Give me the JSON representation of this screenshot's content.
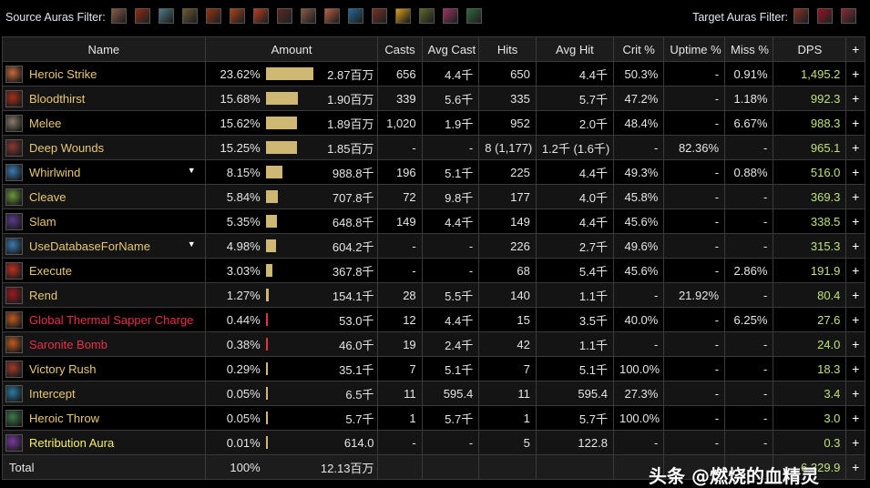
{
  "filters": {
    "source_label": "Source Auras Filter:",
    "source_auras": [
      {
        "name": "flex-arm",
        "color": "#8a5a44"
      },
      {
        "name": "bloodrage",
        "color": "#9a2a10"
      },
      {
        "name": "battle-shout",
        "color": "#4a7a8a"
      },
      {
        "name": "demoralizing",
        "color": "#6a5a30"
      },
      {
        "name": "rampage",
        "color": "#a03010"
      },
      {
        "name": "berserker",
        "color": "#b04010"
      },
      {
        "name": "enrage-fist",
        "color": "#c03a20"
      },
      {
        "name": "claw",
        "color": "#5a2a20"
      },
      {
        "name": "flex-arm-2",
        "color": "#8a5a44"
      },
      {
        "name": "heroic-strike",
        "color": "#c06040"
      },
      {
        "name": "blue-figure",
        "color": "#1a6a9a"
      },
      {
        "name": "demon",
        "color": "#7a3020"
      },
      {
        "name": "fire-yellow",
        "color": "#e0a010"
      },
      {
        "name": "green-beast",
        "color": "#5a6a20"
      },
      {
        "name": "potion",
        "color": "#a03060"
      },
      {
        "name": "green-hand",
        "color": "#2a6a3a"
      }
    ],
    "target_label": "Target Auras Filter:",
    "target_auras": [
      {
        "name": "sunder",
        "color": "#8a3020"
      },
      {
        "name": "rend",
        "color": "#a01020"
      },
      {
        "name": "deep-wounds",
        "color": "#8a2a30"
      }
    ]
  },
  "table": {
    "headers": [
      "Name",
      "Amount",
      "Casts",
      "Avg Cast",
      "Hits",
      "Avg Hit",
      "Crit %",
      "Uptime %",
      "Miss %",
      "DPS",
      "+"
    ],
    "rows": [
      {
        "name": "Heroic Strike",
        "style": "",
        "icon_color": "#c66a3a",
        "pct": "23.62%",
        "bar_fraction": 1.0,
        "bar_color": "gold",
        "amount": "2.87百万",
        "casts": "656",
        "avg_cast": "4.4千",
        "hits": "650",
        "avg_hit": "4.4千",
        "crit": "50.3%",
        "uptime": "-",
        "miss": "0.91%",
        "dps": "1,495.2",
        "expand": false
      },
      {
        "name": "Bloodthirst",
        "style": "",
        "icon_color": "#a8301a",
        "pct": "15.68%",
        "bar_fraction": 0.664,
        "bar_color": "gold",
        "amount": "1.90百万",
        "casts": "339",
        "avg_cast": "5.6千",
        "hits": "335",
        "avg_hit": "5.7千",
        "crit": "47.2%",
        "uptime": "-",
        "miss": "1.18%",
        "dps": "992.3",
        "expand": false
      },
      {
        "name": "Melee",
        "style": "",
        "icon_color": "#8a7a6a",
        "pct": "15.62%",
        "bar_fraction": 0.661,
        "bar_color": "gold",
        "amount": "1.89百万",
        "casts": "1,020",
        "avg_cast": "1.9千",
        "hits": "952",
        "avg_hit": "2.0千",
        "crit": "48.4%",
        "uptime": "-",
        "miss": "6.67%",
        "dps": "988.3",
        "expand": false
      },
      {
        "name": "Deep Wounds",
        "style": "",
        "icon_color": "#8a3a30",
        "pct": "15.25%",
        "bar_fraction": 0.646,
        "bar_color": "gold",
        "amount": "1.85百万",
        "casts": "-",
        "avg_cast": "-",
        "hits": "8 (1,177)",
        "avg_hit": "1.2千 (1.6千)",
        "crit": "-",
        "uptime": "82.36%",
        "miss": "-",
        "dps": "965.1",
        "expand": false
      },
      {
        "name": "Whirlwind",
        "style": "",
        "icon_color": "#3a7ab0",
        "pct": "8.15%",
        "bar_fraction": 0.345,
        "bar_color": "gold",
        "amount": "988.8千",
        "casts": "196",
        "avg_cast": "5.1千",
        "hits": "225",
        "avg_hit": "4.4千",
        "crit": "49.3%",
        "uptime": "-",
        "miss": "0.88%",
        "dps": "516.0",
        "expand": true
      },
      {
        "name": "Cleave",
        "style": "",
        "icon_color": "#6a9a3a",
        "pct": "5.84%",
        "bar_fraction": 0.247,
        "bar_color": "gold",
        "amount": "707.8千",
        "casts": "72",
        "avg_cast": "9.8千",
        "hits": "177",
        "avg_hit": "4.0千",
        "crit": "45.8%",
        "uptime": "-",
        "miss": "-",
        "dps": "369.3",
        "expand": false
      },
      {
        "name": "Slam",
        "style": "",
        "icon_color": "#5a3a8a",
        "pct": "5.35%",
        "bar_fraction": 0.227,
        "bar_color": "gold",
        "amount": "648.8千",
        "casts": "149",
        "avg_cast": "4.4千",
        "hits": "149",
        "avg_hit": "4.4千",
        "crit": "45.6%",
        "uptime": "-",
        "miss": "-",
        "dps": "338.5",
        "expand": false
      },
      {
        "name": "UseDatabaseForName",
        "style": "",
        "icon_color": "#3a7ab0",
        "pct": "4.98%",
        "bar_fraction": 0.211,
        "bar_color": "gold",
        "amount": "604.2千",
        "casts": "-",
        "avg_cast": "-",
        "hits": "226",
        "avg_hit": "2.7千",
        "crit": "49.6%",
        "uptime": "-",
        "miss": "-",
        "dps": "315.3",
        "expand": true
      },
      {
        "name": "Execute",
        "style": "",
        "icon_color": "#c03020",
        "pct": "3.03%",
        "bar_fraction": 0.128,
        "bar_color": "gold",
        "amount": "367.8千",
        "casts": "-",
        "avg_cast": "-",
        "hits": "68",
        "avg_hit": "5.4千",
        "crit": "45.6%",
        "uptime": "-",
        "miss": "2.86%",
        "dps": "191.9",
        "expand": false
      },
      {
        "name": "Rend",
        "style": "",
        "icon_color": "#a01a20",
        "pct": "1.27%",
        "bar_fraction": 0.054,
        "bar_color": "gold",
        "amount": "154.1千",
        "casts": "28",
        "avg_cast": "5.5千",
        "hits": "140",
        "avg_hit": "1.1千",
        "crit": "-",
        "uptime": "21.92%",
        "miss": "-",
        "dps": "80.4",
        "expand": false
      },
      {
        "name": "Global Thermal Sapper Charge",
        "style": "red",
        "icon_color": "#c05a20",
        "pct": "0.44%",
        "bar_fraction": 0.019,
        "bar_color": "red",
        "amount": "53.0千",
        "casts": "12",
        "avg_cast": "4.4千",
        "hits": "15",
        "avg_hit": "3.5千",
        "crit": "40.0%",
        "uptime": "-",
        "miss": "6.25%",
        "dps": "27.6",
        "expand": false
      },
      {
        "name": "Saronite Bomb",
        "style": "red",
        "icon_color": "#c05a20",
        "pct": "0.38%",
        "bar_fraction": 0.016,
        "bar_color": "red",
        "amount": "46.0千",
        "casts": "19",
        "avg_cast": "2.4千",
        "hits": "42",
        "avg_hit": "1.1千",
        "crit": "-",
        "uptime": "-",
        "miss": "-",
        "dps": "24.0",
        "expand": false
      },
      {
        "name": "Victory Rush",
        "style": "",
        "icon_color": "#a03a2a",
        "pct": "0.29%",
        "bar_fraction": 0.012,
        "bar_color": "gold",
        "amount": "35.1千",
        "casts": "7",
        "avg_cast": "5.1千",
        "hits": "7",
        "avg_hit": "5.1千",
        "crit": "100.0%",
        "uptime": "-",
        "miss": "-",
        "dps": "18.3",
        "expand": false
      },
      {
        "name": "Intercept",
        "style": "",
        "icon_color": "#2a7aa0",
        "pct": "0.05%",
        "bar_fraction": 0.002,
        "bar_color": "gold",
        "amount": "6.5千",
        "casts": "11",
        "avg_cast": "595.4",
        "hits": "11",
        "avg_hit": "595.4",
        "crit": "27.3%",
        "uptime": "-",
        "miss": "-",
        "dps": "3.4",
        "expand": false
      },
      {
        "name": "Heroic Throw",
        "style": "",
        "icon_color": "#3a7a4a",
        "pct": "0.05%",
        "bar_fraction": 0.002,
        "bar_color": "gold",
        "amount": "5.7千",
        "casts": "1",
        "avg_cast": "5.7千",
        "hits": "1",
        "avg_hit": "5.7千",
        "crit": "100.0%",
        "uptime": "-",
        "miss": "-",
        "dps": "3.0",
        "expand": false
      },
      {
        "name": "Retribution Aura",
        "style": "yellow",
        "icon_color": "#7a3aa0",
        "pct": "0.01%",
        "bar_fraction": 0.0004,
        "bar_color": "gold",
        "amount": "614.0",
        "casts": "-",
        "avg_cast": "-",
        "hits": "5",
        "avg_hit": "122.8",
        "crit": "-",
        "uptime": "-",
        "miss": "-",
        "dps": "0.3",
        "expand": false
      }
    ],
    "total": {
      "label": "Total",
      "pct": "100%",
      "amount": "12.13百万",
      "dps": "6,329.9"
    }
  },
  "watermark": "头条 @燃烧的血精灵",
  "colors": {
    "bar_gold": "#cfb874",
    "bar_red": "#e8304a",
    "dps_green": "#bfe37a",
    "name_gold": "#e8c872"
  }
}
